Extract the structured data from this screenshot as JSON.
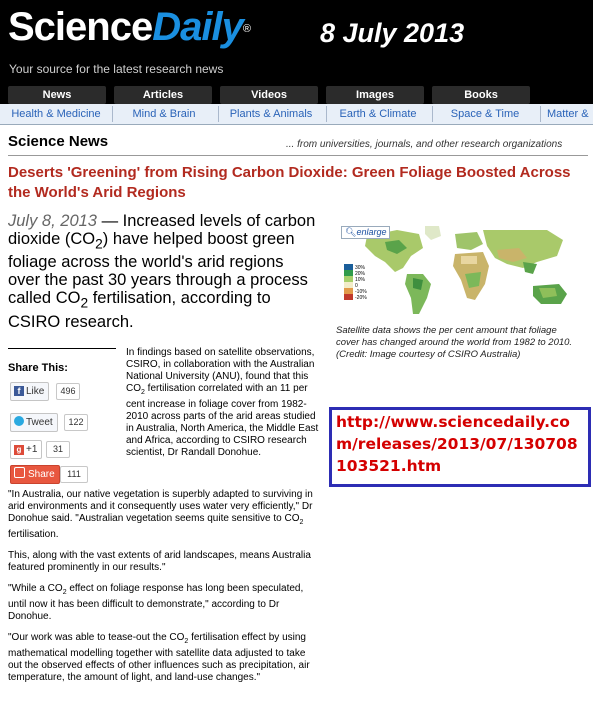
{
  "header": {
    "logo_science": "Science",
    "logo_daily": "Daily",
    "logo_reg": "®",
    "tagline": "Your source for the latest research news",
    "date_overlay": "8 July 2013"
  },
  "nav_primary": [
    "News",
    "Articles",
    "Videos",
    "Images",
    "Books"
  ],
  "nav_secondary": [
    "Health & Medicine",
    "Mind & Brain",
    "Plants & Animals",
    "Earth & Climate",
    "Space & Time",
    "Matter &"
  ],
  "section": {
    "title": "Science News",
    "subtitle": "... from universities, journals, and other research organizations"
  },
  "article": {
    "headline": "Deserts 'Greening' from Rising Carbon Dioxide: Green Foliage Boosted Across the World's Arid Regions",
    "lead_date": "July 8, 2013",
    "lead_text_1": " — Increased levels of carbon dioxide (CO",
    "lead_text_2": ") have helped boost green foliage across the world's arid regions over the past 30 years through a process called CO",
    "lead_text_3": " fertilisation, according to CSIRO research.",
    "sub2": "2",
    "para1_a": "In findings based on satellite observations, CSIRO, in collaboration with the Australian National University (ANU), found that this CO",
    "para1_b": " fertilisation correlated with an 11 per cent increase in foliage cover from 1982-2010 across parts of the arid areas studied in Australia, North America, the Middle East and Africa, according to CSIRO research scientist, Dr Randall Donohue.",
    "para2_a": "\"In Australia, our native vegetation is superbly adapted to surviving in arid environments and it consequently uses water very efficiently,\" Dr Donohue said. \"Australian vegetation seems quite sensitive to CO",
    "para2_b": " fertilisation.",
    "para3": "This, along with the vast extents of arid landscapes, means Australia featured prominently in our results.\"",
    "para4_a": "\"While a CO",
    "para4_b": " effect on foliage response has long been speculated, until now it has been difficult to demonstrate,\" according to Dr Donohue.",
    "para5_a": "\"Our work was able to tease-out the CO",
    "para5_b": " fertilisation effect by using mathematical modelling together with satellite data adjusted to take out the observed effects of other influences such as precipitation, air temperature, the amount of light, and land-use changes.\""
  },
  "share": {
    "title": "Share This:",
    "buttons": [
      {
        "label": "Like",
        "count": "496",
        "icon": "facebook-icon"
      },
      {
        "label": "Tweet",
        "count": "122",
        "icon": "twitter-icon"
      },
      {
        "label": "+1",
        "count": "31",
        "icon": "google-plus-icon"
      },
      {
        "label": "Share",
        "count": "111",
        "icon": "share-icon"
      }
    ]
  },
  "figure": {
    "enlarge": "enlarge",
    "caption": "Satellite data shows the per cent amount that foliage cover has changed around the world from 1982 to 2010. (Credit: Image courtesy of CSIRO Australia)",
    "legend": [
      "30%",
      "20%",
      "10%",
      "0",
      "-10%",
      "-20%"
    ]
  },
  "source_url": "http://www.sciencedaily.com/releases/2013/07/130708103521.htm",
  "colors": {
    "headline": "#b22a1f",
    "daily_blue": "#1a8fe0",
    "nav_link": "#2a63b8",
    "url_red": "#d40000",
    "url_border": "#2d2db4"
  }
}
